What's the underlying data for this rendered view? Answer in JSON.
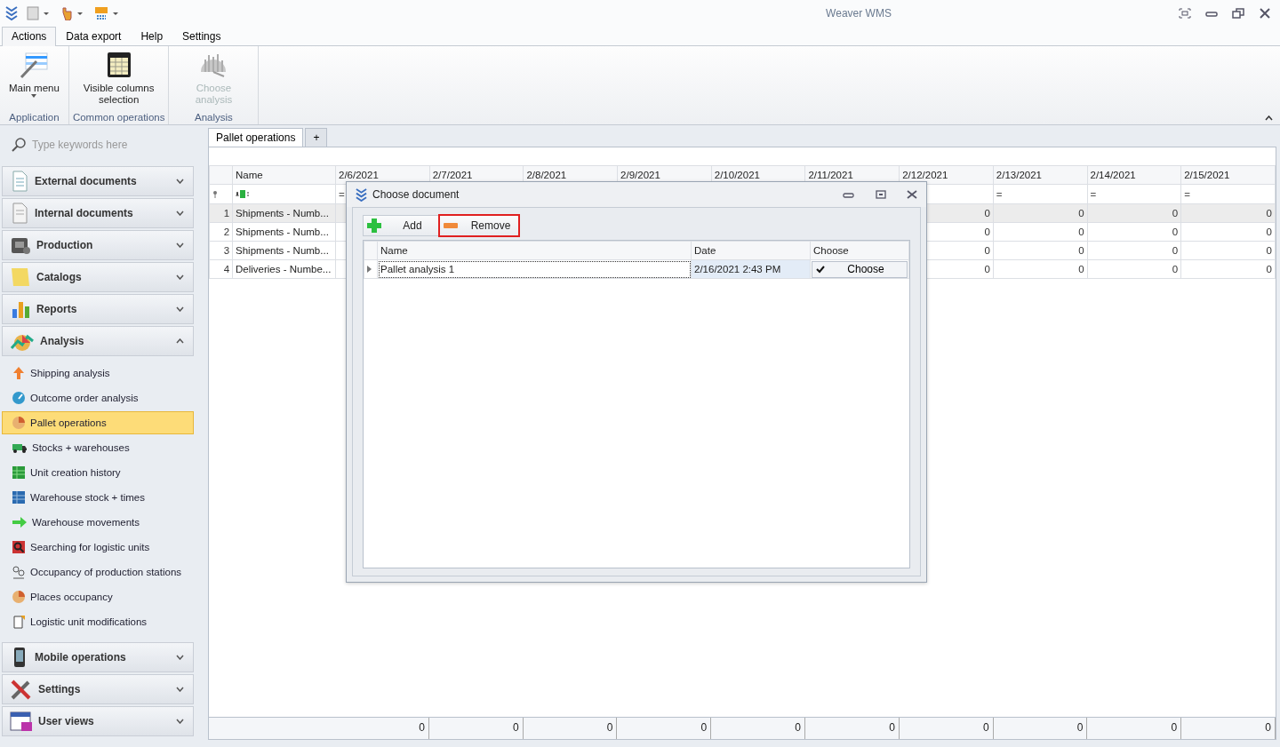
{
  "window": {
    "title": "Weaver WMS"
  },
  "ribbon": {
    "tabs": [
      {
        "label": "Actions",
        "selected": true
      },
      {
        "label": "Data export",
        "selected": false
      },
      {
        "label": "Help",
        "selected": false
      },
      {
        "label": "Settings",
        "selected": false
      }
    ],
    "groups": [
      {
        "caption": "Application",
        "buttons": [
          {
            "label": "Main menu",
            "dropdown": true,
            "disabled": false
          }
        ]
      },
      {
        "caption": "Common operations",
        "buttons": [
          {
            "label": "Visible columns selection",
            "dropdown": false,
            "disabled": false
          }
        ]
      },
      {
        "caption": "Analysis",
        "buttons": [
          {
            "label": "Choose analysis",
            "dropdown": false,
            "disabled": true
          }
        ]
      }
    ]
  },
  "sidebar": {
    "search": {
      "placeholder": "Type keywords here"
    },
    "groups": [
      {
        "label": "External documents",
        "expanded": false
      },
      {
        "label": "Internal documents",
        "expanded": false
      },
      {
        "label": "Production",
        "expanded": false
      },
      {
        "label": "Catalogs",
        "expanded": false
      },
      {
        "label": "Reports",
        "expanded": false
      },
      {
        "label": "Analysis",
        "expanded": true,
        "items": [
          {
            "label": "Shipping analysis",
            "selected": false
          },
          {
            "label": "Outcome order analysis",
            "selected": false
          },
          {
            "label": "Pallet operations",
            "selected": true
          },
          {
            "label": "Stocks + warehouses",
            "selected": false
          },
          {
            "label": "Unit creation history",
            "selected": false
          },
          {
            "label": "Warehouse stock + times",
            "selected": false
          },
          {
            "label": "Warehouse movements",
            "selected": false
          },
          {
            "label": "Searching for logistic units",
            "selected": false
          },
          {
            "label": "Occupancy of production stations",
            "selected": false
          },
          {
            "label": "Places occupancy",
            "selected": false
          },
          {
            "label": "Logistic unit modifications",
            "selected": false
          }
        ]
      },
      {
        "label": "Mobile operations",
        "expanded": false
      },
      {
        "label": "Settings",
        "expanded": false
      },
      {
        "label": "User views",
        "expanded": false
      }
    ]
  },
  "document_tabs": [
    {
      "label": "Pallet operations",
      "selected": true
    },
    {
      "label": "+",
      "selected": false
    }
  ],
  "grid": {
    "columns": [
      {
        "header": "Name"
      },
      {
        "header": "2/6/2021",
        "filter": "="
      },
      {
        "header": "2/7/2021"
      },
      {
        "header": "2/8/2021"
      },
      {
        "header": "2/9/2021"
      },
      {
        "header": "2/10/2021"
      },
      {
        "header": "2/11/2021"
      },
      {
        "header": "2/12/2021"
      },
      {
        "header": "2/13/2021",
        "filter": "="
      },
      {
        "header": "2/14/2021",
        "filter": "="
      },
      {
        "header": "2/15/2021",
        "filter": "="
      }
    ],
    "rows": [
      {
        "number": "1",
        "name": "Shipments - Numb...",
        "selected": true,
        "trailing_values": [
          "0",
          "0",
          "0",
          "0"
        ]
      },
      {
        "number": "2",
        "name": "Shipments - Numb...",
        "selected": false,
        "trailing_values": [
          "0",
          "0",
          "0",
          "0"
        ]
      },
      {
        "number": "3",
        "name": "Shipments - Numb...",
        "selected": false,
        "trailing_values": [
          "0",
          "0",
          "0",
          "0"
        ]
      },
      {
        "number": "4",
        "name": "Deliveries - Numbe...",
        "selected": false,
        "trailing_values": [
          "0",
          "0",
          "0",
          "0"
        ]
      }
    ],
    "totals": [
      "0",
      "0",
      "0",
      "0",
      "0",
      "0",
      "0",
      "0",
      "0",
      "0"
    ]
  },
  "dialog": {
    "title": "Choose document",
    "toolbar": [
      {
        "kind": "add",
        "label": "Add",
        "highlighted": false
      },
      {
        "kind": "remove",
        "label": "Remove",
        "highlighted": true
      }
    ],
    "columns": [
      "Name",
      "Date",
      "Choose"
    ],
    "rows": [
      {
        "name": "Pallet analysis 1",
        "date": "2/16/2021 2:43 PM",
        "action": "Choose",
        "checked": true
      }
    ]
  }
}
